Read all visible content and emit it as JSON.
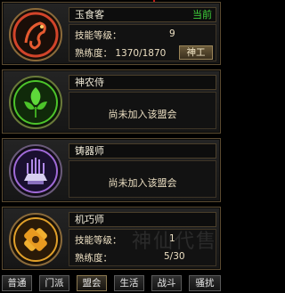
{
  "skills": [
    {
      "name": "玉食客",
      "current_tag": "当前",
      "skill_level_label": "技能等级：",
      "skill_level_value": "9",
      "proficiency_label": "熟练度：",
      "proficiency_value": "1370/1870",
      "title_button": "神工",
      "emblem_color": "#d2442a"
    },
    {
      "name": "神农侍",
      "status_text": "尚未加入该盟会",
      "emblem_color": "#4cc42a"
    },
    {
      "name": "铸器师",
      "status_text": "尚未加入该盟会",
      "emblem_color": "#a06ad8"
    },
    {
      "name": "机巧师",
      "skill_level_label": "技能等级：",
      "skill_level_value": "1",
      "proficiency_label": "熟练度：",
      "proficiency_value": "5/30",
      "emblem_color": "#e0a02a"
    }
  ],
  "tabs": [
    "普通",
    "门派",
    "盟会",
    "生活",
    "战斗",
    "骚扰"
  ],
  "watermark": "神仙代售"
}
